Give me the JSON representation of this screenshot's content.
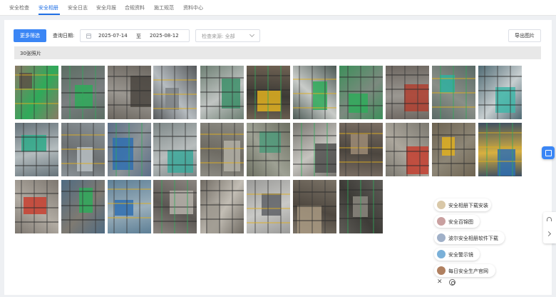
{
  "tabs": [
    {
      "label": "安全检查",
      "active": false
    },
    {
      "label": "安全相册",
      "active": true
    },
    {
      "label": "安全日志",
      "active": false
    },
    {
      "label": "安全月报",
      "active": false
    },
    {
      "label": "合规资料",
      "active": false
    },
    {
      "label": "施工规范",
      "active": false
    },
    {
      "label": "资料中心",
      "active": false
    }
  ],
  "filters": {
    "more_filter_label": "更多筛选",
    "query_date_label": "查询日期:",
    "date_start": "2025-07-14",
    "date_separator": "至",
    "date_end": "2025-08-12",
    "source_select": "检查来源: 全部",
    "export_label": "导出图片"
  },
  "photo_count": "30张照片",
  "photos_count_total": 30,
  "widgets": [
    {
      "label": "安全相册下载安装",
      "icon": "download-app-icon"
    },
    {
      "label": "安全百锦图",
      "icon": "gallery-icon"
    },
    {
      "label": "波尔安全相册软件下载",
      "icon": "software-icon"
    },
    {
      "label": "安全警示镜",
      "icon": "mirror-icon"
    },
    {
      "label": "每日安全生产官网",
      "icon": "website-icon"
    }
  ],
  "colors": {
    "accent": "#1f6fe5",
    "primary_button": "#3b86f5",
    "net_green": "#2faa5a",
    "scaffold_yellow": "#e0b020"
  }
}
